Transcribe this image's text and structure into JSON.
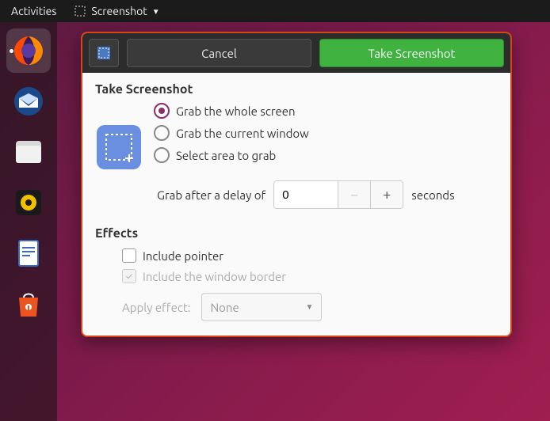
{
  "topbar": {
    "activities": "Activities",
    "app_name": "Screenshot"
  },
  "dock": {
    "items": [
      "firefox",
      "thunderbird",
      "files",
      "rhythmbox",
      "libreoffice-writer",
      "software-center"
    ],
    "active_index": 0
  },
  "titlebar": {
    "cancel": "Cancel",
    "primary": "Take Screenshot"
  },
  "capture": {
    "title": "Take Screenshot",
    "options": [
      "Grab the whole screen",
      "Grab the current window",
      "Select area to grab"
    ],
    "selected": 0,
    "delay_label_before": "Grab after a delay of",
    "delay_value": "0",
    "delay_label_after": "seconds"
  },
  "effects": {
    "title": "Effects",
    "include_pointer": "Include pointer",
    "include_border": "Include the window border",
    "apply_label": "Apply effect:",
    "apply_value": "None"
  }
}
